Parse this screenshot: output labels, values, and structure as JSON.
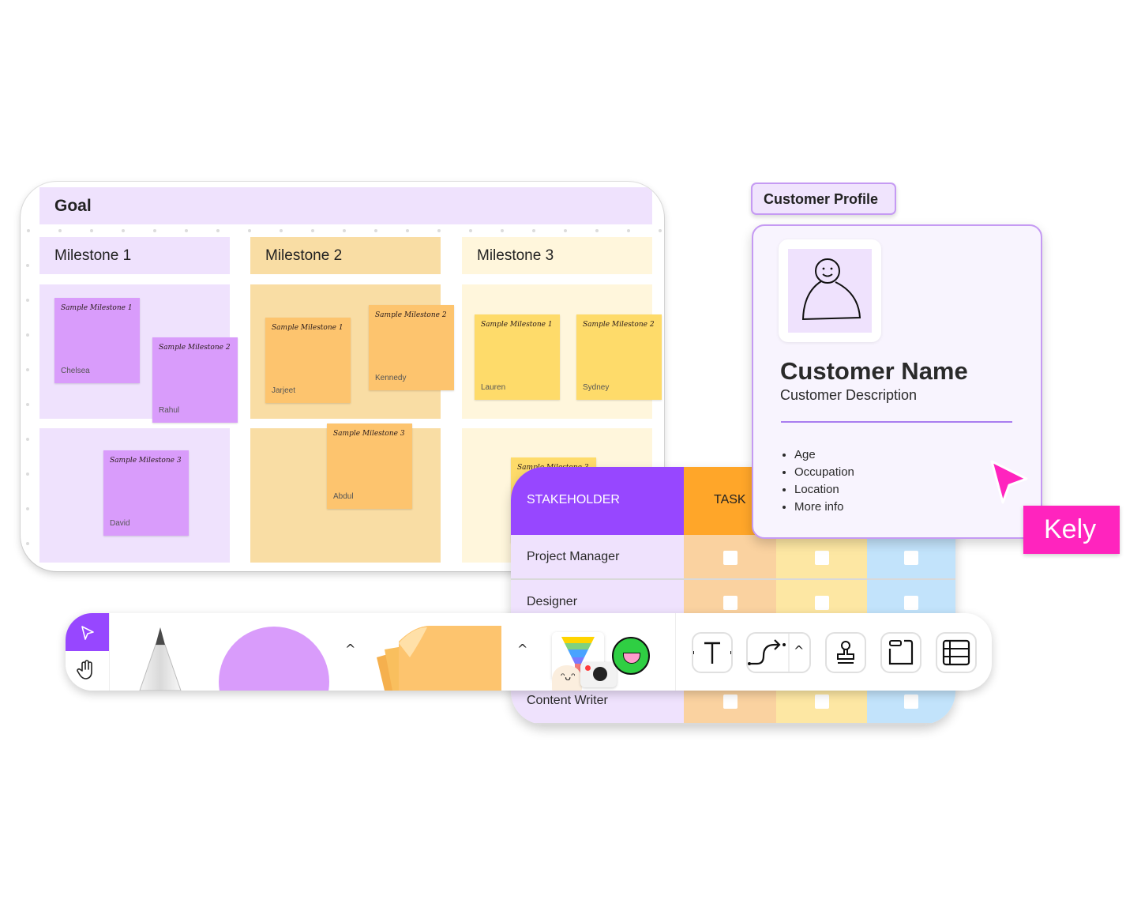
{
  "board": {
    "goal_label": "Goal",
    "milestones": [
      {
        "label": "Milestone 1",
        "color": "#efe2fd"
      },
      {
        "label": "Milestone 2",
        "color": "#f9dda4"
      },
      {
        "label": "Milestone 3",
        "color": "#fff6dc"
      }
    ],
    "stickies": [
      {
        "title": "Sample Milestone 1",
        "author": "Chelsea"
      },
      {
        "title": "Sample Milestone 2",
        "author": "Rahul"
      },
      {
        "title": "Sample Milestone 3",
        "author": "David"
      },
      {
        "title": "Sample Milestone 1",
        "author": "Jarjeet"
      },
      {
        "title": "Sample Milestone 2",
        "author": "Kennedy"
      },
      {
        "title": "Sample Milestone 3",
        "author": "Abdul"
      },
      {
        "title": "Sample Milestone 1",
        "author": "Lauren"
      },
      {
        "title": "Sample Milestone 2",
        "author": "Sydney"
      },
      {
        "title": "Sample Milestone 3",
        "author": ""
      }
    ]
  },
  "customer_profile": {
    "tag_label": "Customer Profile",
    "name": "Customer Name",
    "description": "Customer Description",
    "fields": [
      "Age",
      "Occupation",
      "Location",
      "More info"
    ]
  },
  "stakeholder_table": {
    "header_stakeholder": "STAKEHOLDER",
    "header_task": "TASK",
    "rows": [
      "Project Manager",
      "Designer",
      "Content Writer"
    ]
  },
  "cursor": {
    "user_label": "Kely",
    "color": "#ff24be"
  },
  "toolbar": {
    "tools": [
      "select",
      "hand",
      "pen",
      "shape",
      "sticky-note",
      "templates",
      "text",
      "connector",
      "stamp",
      "frame",
      "table"
    ],
    "accent": "#9747ff"
  }
}
